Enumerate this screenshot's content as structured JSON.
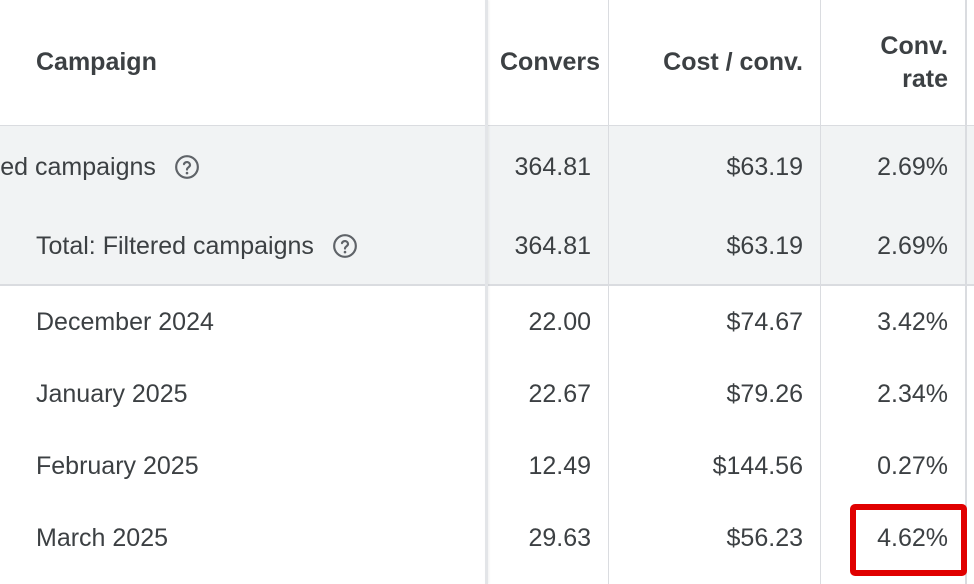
{
  "header": {
    "campaign": "Campaign",
    "conversions": "Convers",
    "cost_per_conv": "Cost / conv.",
    "conv_rate_line1": "Conv.",
    "conv_rate_line2": "rate"
  },
  "summary_rows": [
    {
      "label": "ered campaigns",
      "conversions": "364.81",
      "cost_per_conv": "$63.19",
      "conv_rate": "2.69%"
    },
    {
      "label": "Total: Filtered campaigns",
      "conversions": "364.81",
      "cost_per_conv": "$63.19",
      "conv_rate": "2.69%"
    }
  ],
  "rows": [
    {
      "campaign": "December 2024",
      "conversions": "22.00",
      "cost_per_conv": "$74.67",
      "conv_rate": "3.42%"
    },
    {
      "campaign": "January 2025",
      "conversions": "22.67",
      "cost_per_conv": "$79.26",
      "conv_rate": "2.34%"
    },
    {
      "campaign": "February 2025",
      "conversions": "12.49",
      "cost_per_conv": "$144.56",
      "conv_rate": "0.27%"
    },
    {
      "campaign": "March 2025",
      "conversions": "29.63",
      "cost_per_conv": "$56.23",
      "conv_rate": "4.62%"
    }
  ],
  "colors": {
    "highlight": "#e00000",
    "summary_bg": "#f1f3f4",
    "border": "#dadce0",
    "text": "#3c4043"
  },
  "icons": {
    "help": "help-circle-icon"
  }
}
